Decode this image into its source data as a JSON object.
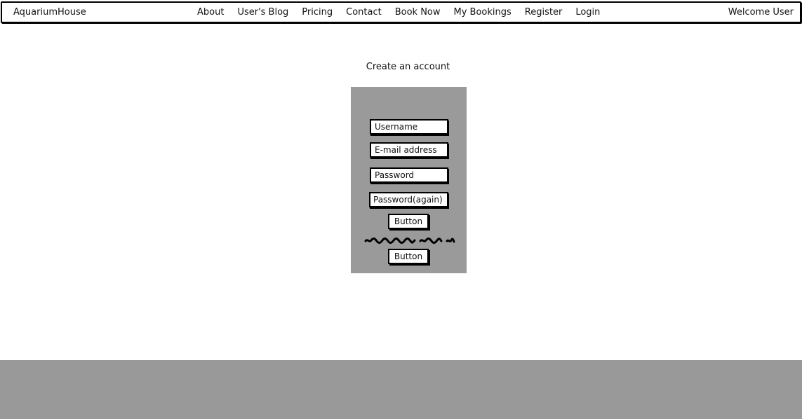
{
  "navbar": {
    "brand": "AquariumHouse",
    "links": [
      "About",
      "User's Blog",
      "Pricing",
      "Contact",
      "Book Now",
      "My Bookings",
      "Register",
      "Login"
    ],
    "welcome": "Welcome User"
  },
  "form": {
    "title": "Create an account",
    "username_placeholder": "Username",
    "email_placeholder": "E-mail address",
    "password_placeholder": "Password",
    "password_again_placeholder": "Password(again)",
    "primary_button_label": "Button",
    "secondary_button_label": "Button"
  },
  "colors": {
    "panel_background": "#9a9a9a",
    "footer_background": "#999999",
    "outline": "#000000"
  }
}
